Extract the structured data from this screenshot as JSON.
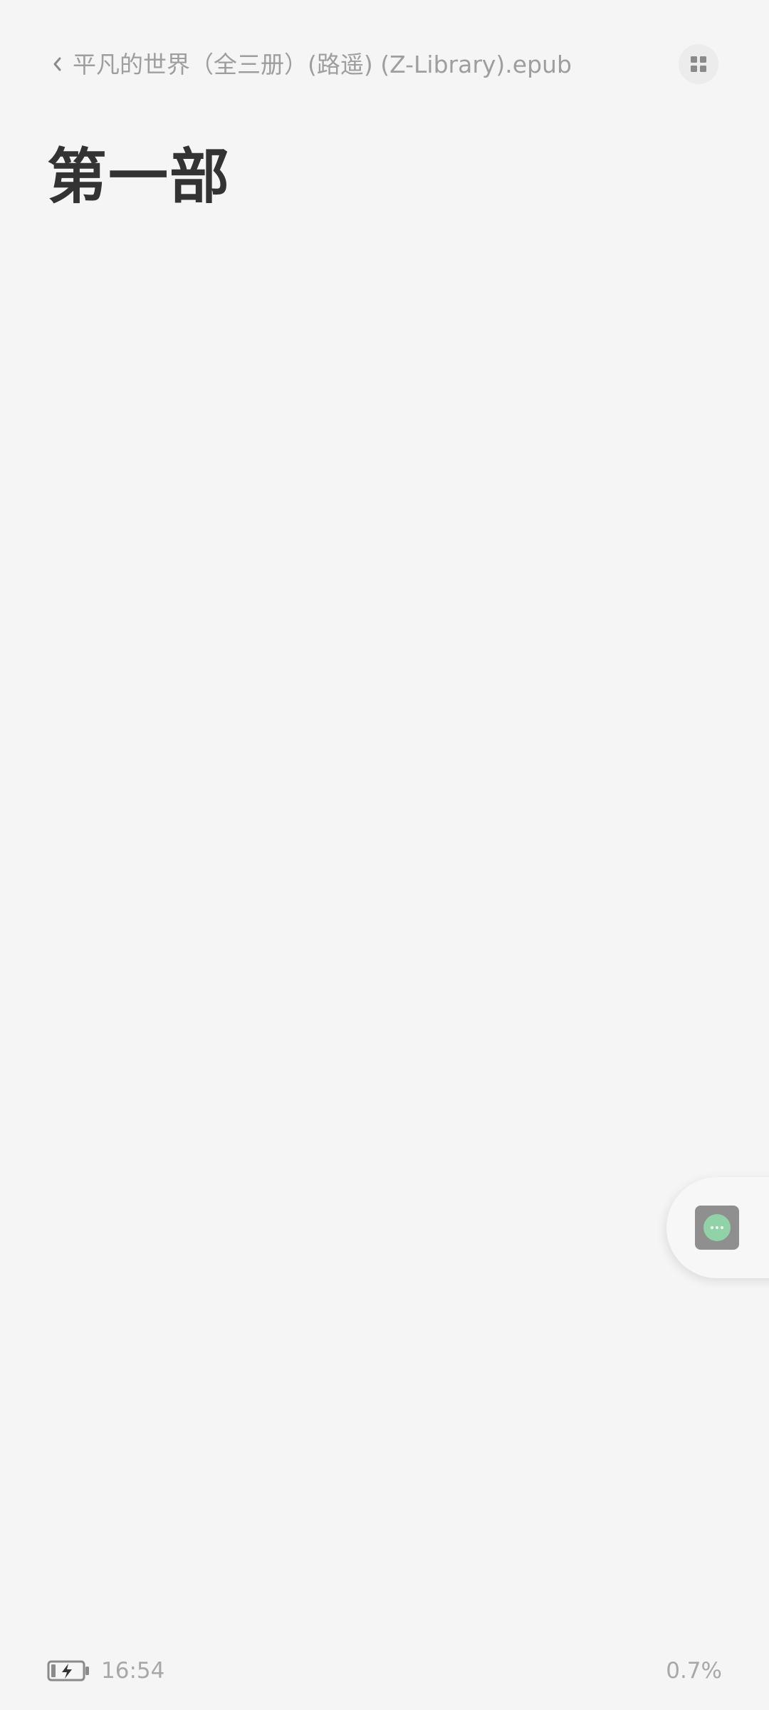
{
  "header": {
    "back_icon": "chevron-left-icon",
    "book_title": "平凡的世界（全三册）(路遥) (Z-Library).epub",
    "menu_icon": "grid-icon"
  },
  "content": {
    "chapter_heading": "第一部"
  },
  "floating_action": {
    "icon": "more-dots-icon",
    "accent_color": "#8fd3a6"
  },
  "status": {
    "battery_icon": "battery-charging-icon",
    "time": "16:54",
    "progress": "0.7%"
  },
  "colors": {
    "background": "#f5f5f5",
    "heading": "#333333",
    "muted_text": "#9e9e9e"
  }
}
